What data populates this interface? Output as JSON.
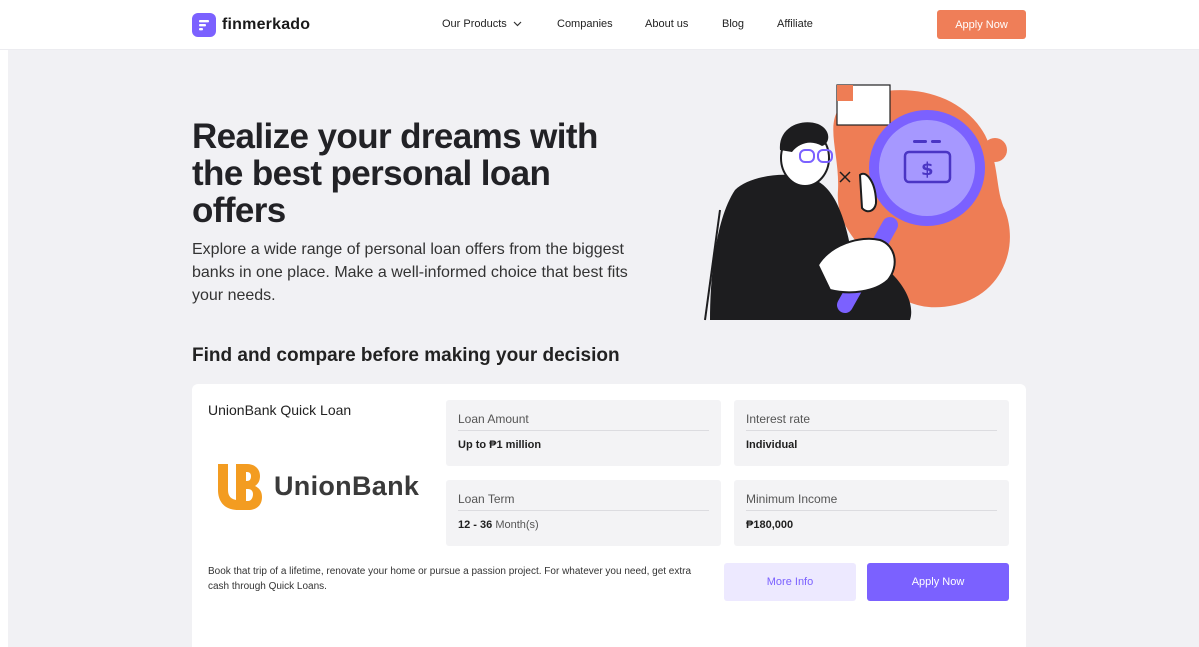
{
  "brand": {
    "name": "finmerkado",
    "primary": "#7b61ff",
    "accent": "#ef7e58"
  },
  "nav": {
    "products": "Our Products",
    "companies": "Companies",
    "about": "About us",
    "blog": "Blog",
    "affiliate": "Affiliate",
    "apply": "Apply Now"
  },
  "hero": {
    "title": "Realize your dreams with the best personal loan offers",
    "subtitle": "Explore a wide range of personal loan offers from the biggest banks in one place. Make a well-informed choice that best fits your needs."
  },
  "compare_heading": "Find and compare before making your decision",
  "offer": {
    "title": "UnionBank Quick Loan",
    "bank_name": "UnionBank",
    "bank_mark": "UB",
    "loan_amount_label": "Loan Amount",
    "loan_amount_value": "Up to ₱1 million",
    "interest_label": "Interest rate",
    "interest_value": "Individual",
    "term_label": "Loan Term",
    "term_value": "12 - 36",
    "term_unit": "Month(s)",
    "income_label": "Minimum Income",
    "income_value": "₱180,000",
    "description": "Book that trip of a lifetime, renovate your home or pursue a passion project. For whatever you need, get extra cash through Quick Loans.",
    "more_info": "More Info",
    "apply": "Apply Now"
  }
}
